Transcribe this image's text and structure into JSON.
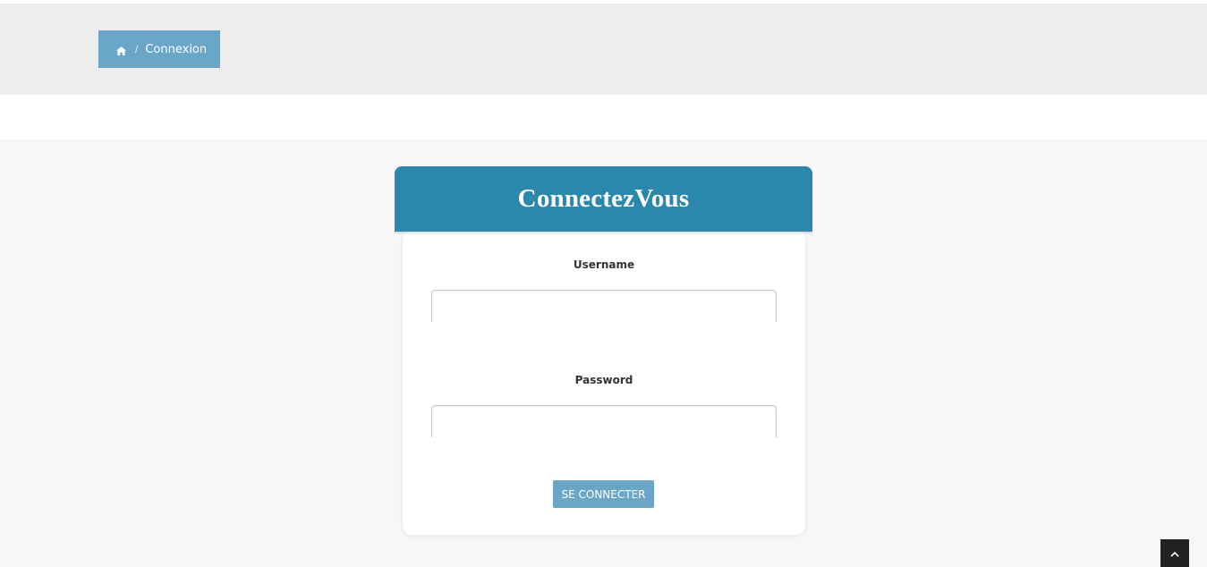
{
  "breadcrumb": {
    "home_icon": "home-icon",
    "separator": "/",
    "current": "Connexion"
  },
  "login_card": {
    "title": "ConnectezVous",
    "username_label": "Username",
    "username_value": "",
    "password_label": "Password",
    "password_value": "",
    "submit_label": "SE CONNECTER"
  },
  "scroll_top": {
    "icon": "chevron-up-icon"
  },
  "colors": {
    "breadcrumb_bg": "#6aa6c8",
    "header_bg": "#2b88ad",
    "button_bg": "#6aa6c8",
    "band_bg": "#ededed",
    "main_bg": "#f7f7f7",
    "scroll_top_bg": "#222222"
  }
}
